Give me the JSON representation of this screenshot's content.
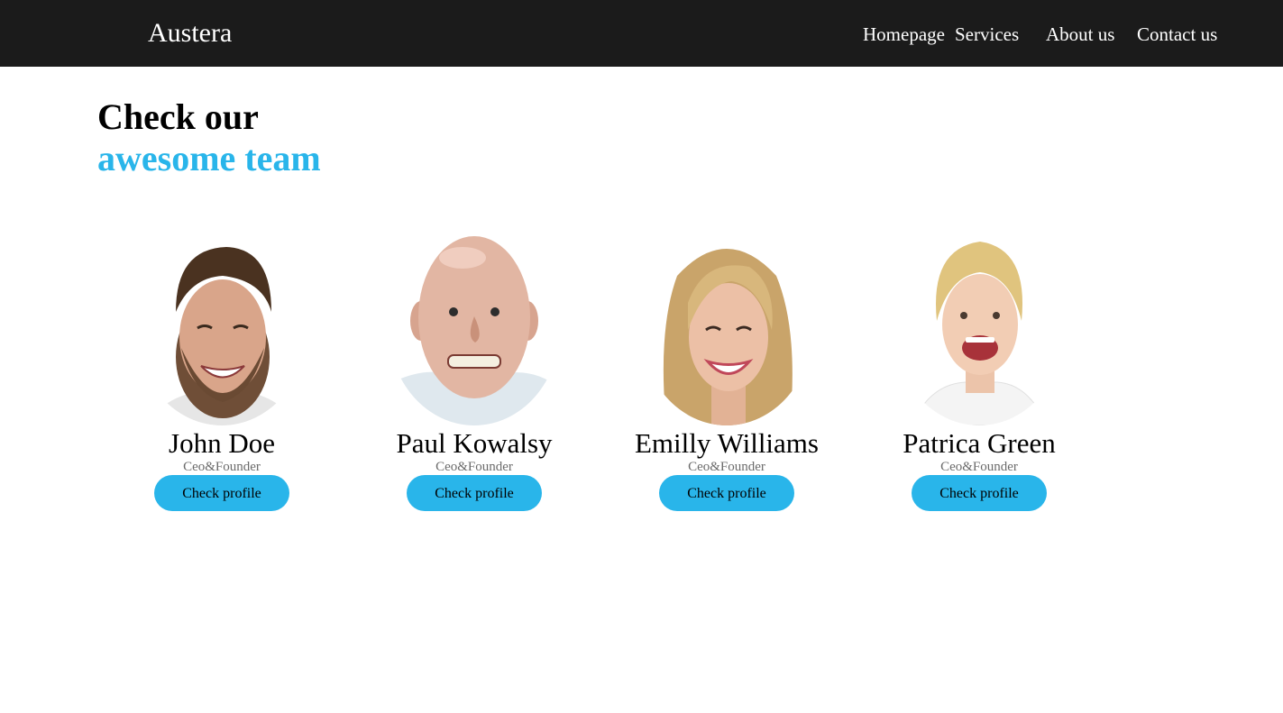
{
  "navbar": {
    "brand": "Austera",
    "links": [
      "Homepage",
      "Services",
      "About us",
      "Contact us"
    ]
  },
  "hero": {
    "line1": "Check our",
    "line2": "awesome team",
    "accent_color": "#29b5ea"
  },
  "team": [
    {
      "name": "John Doe",
      "role": "Ceo&Founder",
      "button": "Check profile",
      "photo": "smiling-young-man-photo"
    },
    {
      "name": "Paul Kowalsy",
      "role": "Ceo&Founder",
      "button": "Check profile",
      "photo": "bald-older-man-photo"
    },
    {
      "name": "Emilly Williams",
      "role": "Ceo&Founder",
      "button": "Check profile",
      "photo": "laughing-blonde-woman-photo"
    },
    {
      "name": "Patrica Green",
      "role": "Ceo&Founder",
      "button": "Check profile",
      "photo": "laughing-blonde-woman-photo"
    }
  ],
  "colors": {
    "navbar": "#1b1b1b",
    "button": "#29b5ea",
    "role_text": "#6b6b6b"
  }
}
